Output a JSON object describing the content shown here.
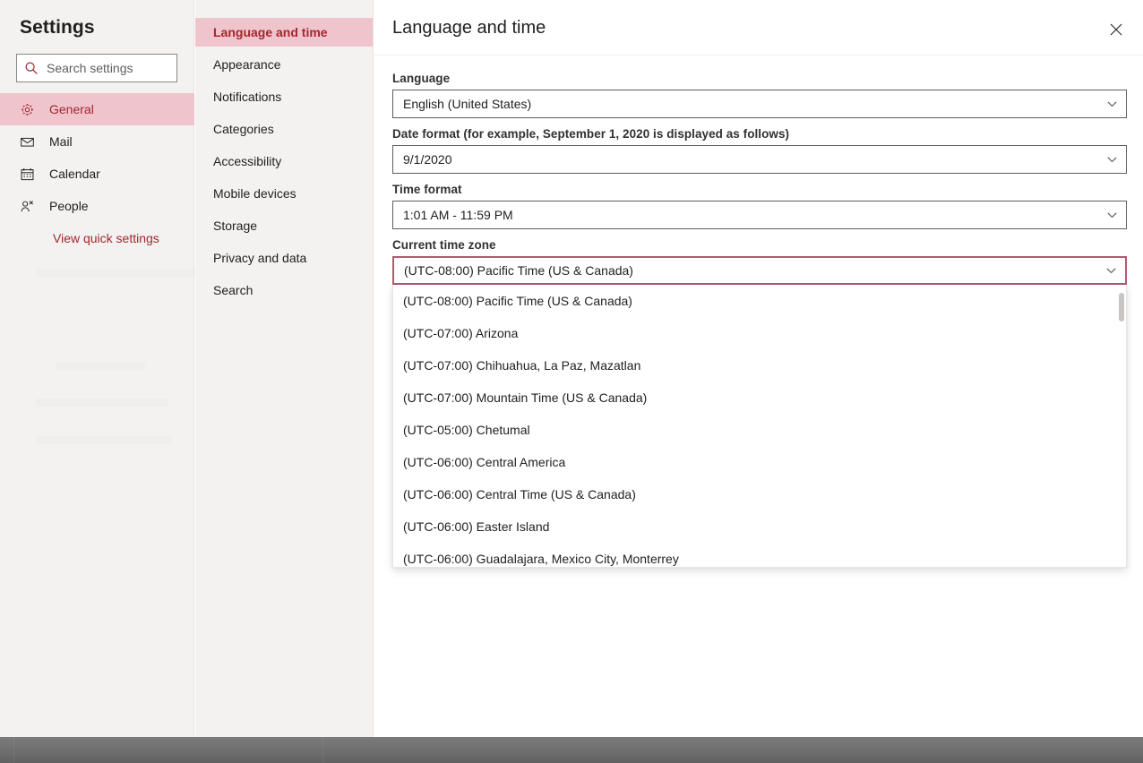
{
  "sidebar": {
    "title": "Settings",
    "search": {
      "placeholder": "Search settings",
      "icon": "search-icon"
    },
    "items": [
      {
        "label": "General",
        "icon": "gear-icon",
        "selected": true
      },
      {
        "label": "Mail",
        "icon": "envelope-icon",
        "selected": false
      },
      {
        "label": "Calendar",
        "icon": "calendar-icon",
        "selected": false
      },
      {
        "label": "People",
        "icon": "people-icon",
        "selected": false
      }
    ],
    "quick_settings_link": "View quick settings"
  },
  "midnav": {
    "items": [
      {
        "label": "Language and time",
        "selected": true
      },
      {
        "label": "Appearance",
        "selected": false
      },
      {
        "label": "Notifications",
        "selected": false
      },
      {
        "label": "Categories",
        "selected": false
      },
      {
        "label": "Accessibility",
        "selected": false
      },
      {
        "label": "Mobile devices",
        "selected": false
      },
      {
        "label": "Storage",
        "selected": false
      },
      {
        "label": "Privacy and data",
        "selected": false
      },
      {
        "label": "Search",
        "selected": false
      }
    ]
  },
  "detail": {
    "title": "Language and time",
    "close_icon": "close-icon",
    "fields": {
      "language": {
        "label": "Language",
        "value": "English (United States)",
        "icon": "chevron-down-icon"
      },
      "date_format": {
        "label": "Date format (for example, September 1, 2020 is displayed as follows)",
        "value": "9/1/2020",
        "icon": "chevron-down-icon"
      },
      "time_format": {
        "label": "Time format",
        "value": "1:01 AM - 11:59 PM",
        "icon": "chevron-down-icon"
      },
      "time_zone": {
        "label": "Current time zone",
        "value": "(UTC-08:00) Pacific Time (US & Canada)",
        "icon": "chevron-down-icon",
        "expanded": true
      }
    },
    "timezone_options": [
      "(UTC-08:00) Pacific Time (US & Canada)",
      "(UTC-07:00) Arizona",
      "(UTC-07:00) Chihuahua, La Paz, Mazatlan",
      "(UTC-07:00) Mountain Time (US & Canada)",
      "(UTC-05:00) Chetumal",
      "(UTC-06:00) Central America",
      "(UTC-06:00) Central Time (US & Canada)",
      "(UTC-06:00) Easter Island",
      "(UTC-06:00) Guadalajara, Mexico City, Monterrey"
    ]
  },
  "colors": {
    "accent": "#a4262c",
    "selected_background": "#f0c4cd",
    "panel_background": "#f3f2f1",
    "focus_border": "#b05a6d",
    "text": "#201f1e",
    "taskbar": "#6f6f6f"
  }
}
